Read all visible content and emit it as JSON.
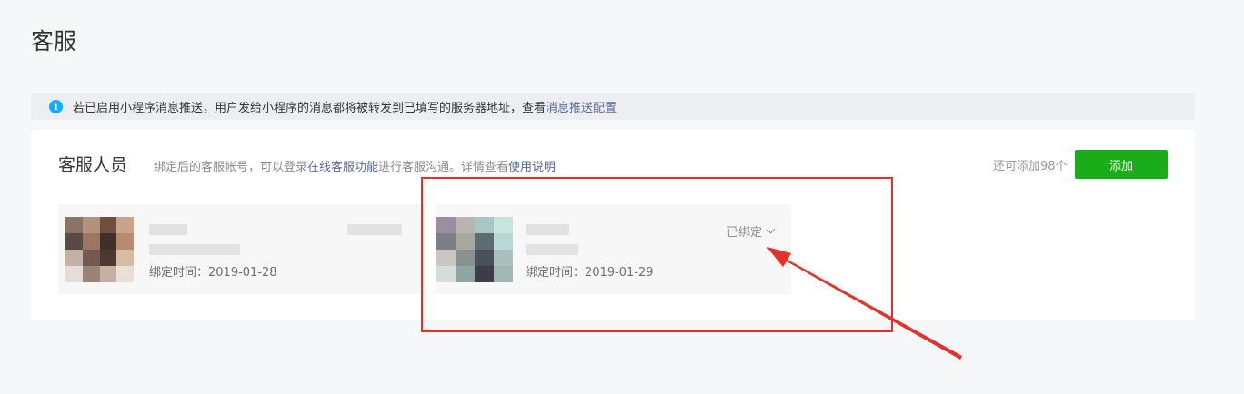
{
  "page": {
    "title": "客服"
  },
  "notice": {
    "text": "若已启用小程序消息推送，用户发给小程序的消息都将被转发到已填写的服务器地址，查看",
    "link": "消息推送配置"
  },
  "staff": {
    "title": "客服人员",
    "desc_prefix": "绑定后的客服帐号，可以登录",
    "desc_link1": "在线客服功能",
    "desc_middle": "进行客服沟通。详情查看",
    "desc_link2": "使用说明",
    "remaining": "还可添加98个",
    "add_label": "添加",
    "members": [
      {
        "bind_time": "绑定时间：2019-01-28"
      },
      {
        "bind_time": "绑定时间：2019-01-29",
        "status": "已绑定"
      }
    ]
  },
  "colors": {
    "primary_green": "#1aad19",
    "link_blue": "#576b95",
    "info_blue": "#10aeff",
    "annotation_red": "#e63029"
  }
}
